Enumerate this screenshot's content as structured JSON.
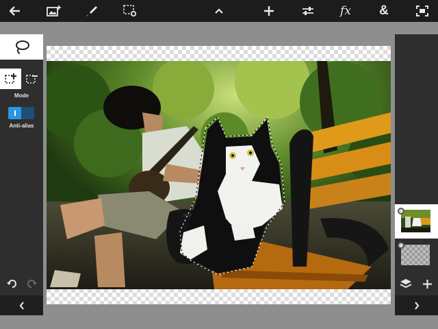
{
  "toolbar": {
    "items": [
      "back-icon",
      "add-image-icon",
      "brush-icon",
      "selection-settings-icon",
      "chevron-up-icon",
      "plus-icon",
      "adjustments-icon",
      "fx-icon",
      "ampersand-icon",
      "fullscreen-icon"
    ],
    "fx_label": "fx",
    "amp_label": "&"
  },
  "left_panel": {
    "active_tool": "lasso-icon",
    "mode_label": "Mode",
    "anti_alias_label": "Anti-alias",
    "anti_alias_enabled": true
  },
  "right_panel": {
    "layers": [
      "photo-layer",
      "empty-layer"
    ],
    "selected_layer_index": 0
  },
  "colors": {
    "topbar": "#1c1c1c",
    "panel": "#2e2e2e",
    "workspace": "#8e8e8e",
    "accent": "#2d95e0"
  }
}
